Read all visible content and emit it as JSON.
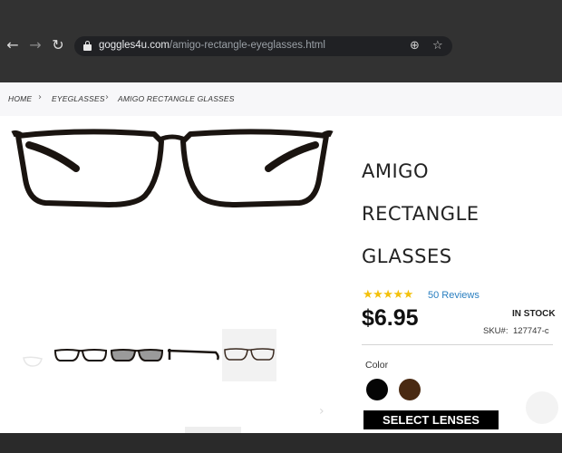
{
  "browser": {
    "url_domain": "goggles4u.com",
    "url_path": "/amigo-rectangle-eyeglasses.html",
    "back_icon": "back-arrow-icon",
    "forward_icon": "forward-arrow-icon",
    "reload_icon": "reload-icon"
  },
  "breadcrumb": {
    "home": "HOME",
    "eyeglasses": "EYEGLASSES",
    "current": "AMIGO RECTANGLE GLASSES"
  },
  "product": {
    "title_line1": "AMIGO",
    "title_line2": "RECTANGLE",
    "title_line3": "GLASSES",
    "rating": 5,
    "reviews_label": "50 Reviews",
    "price": "$6.95",
    "stock": "IN STOCK",
    "sku_label": "SKU#:",
    "sku_value": "127747-c",
    "color_label": "Color",
    "colors": [
      "#050505",
      "#4a2a12"
    ],
    "cta_label": "SELECT LENSES",
    "accent_star": "#f4c10c",
    "accent_link": "#2a7fc0"
  }
}
